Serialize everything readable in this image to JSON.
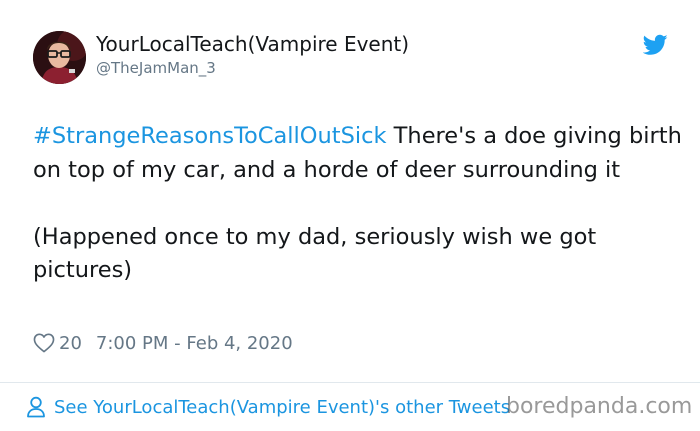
{
  "author": {
    "display_name": "YourLocalTeach(Vampire Event)",
    "handle": "@TheJamMan_3",
    "avatar_icon": "avatar-photo"
  },
  "tweet": {
    "hashtag": "#StrangeReasonsToCallOutSick",
    "paragraph1_text": " There's a doe giving birth on top of my car, and a horde of deer surrounding it",
    "paragraph2_text": "(Happened once to my dad, seriously wish we got pictures)"
  },
  "meta": {
    "like_icon": "heart-icon",
    "like_count": "20",
    "timestamp": "7:00 PM - Feb 4, 2020"
  },
  "footer": {
    "icon": "person-icon",
    "link_text": "See YourLocalTeach(Vampire Event)'s other Tweets"
  },
  "watermark": "boredpanda.com",
  "colors": {
    "text": "#14171a",
    "secondary_text": "#657786",
    "link_blue": "#1b95e0",
    "twitter_blue": "#1da1f2",
    "divider": "#e1e8ed"
  }
}
